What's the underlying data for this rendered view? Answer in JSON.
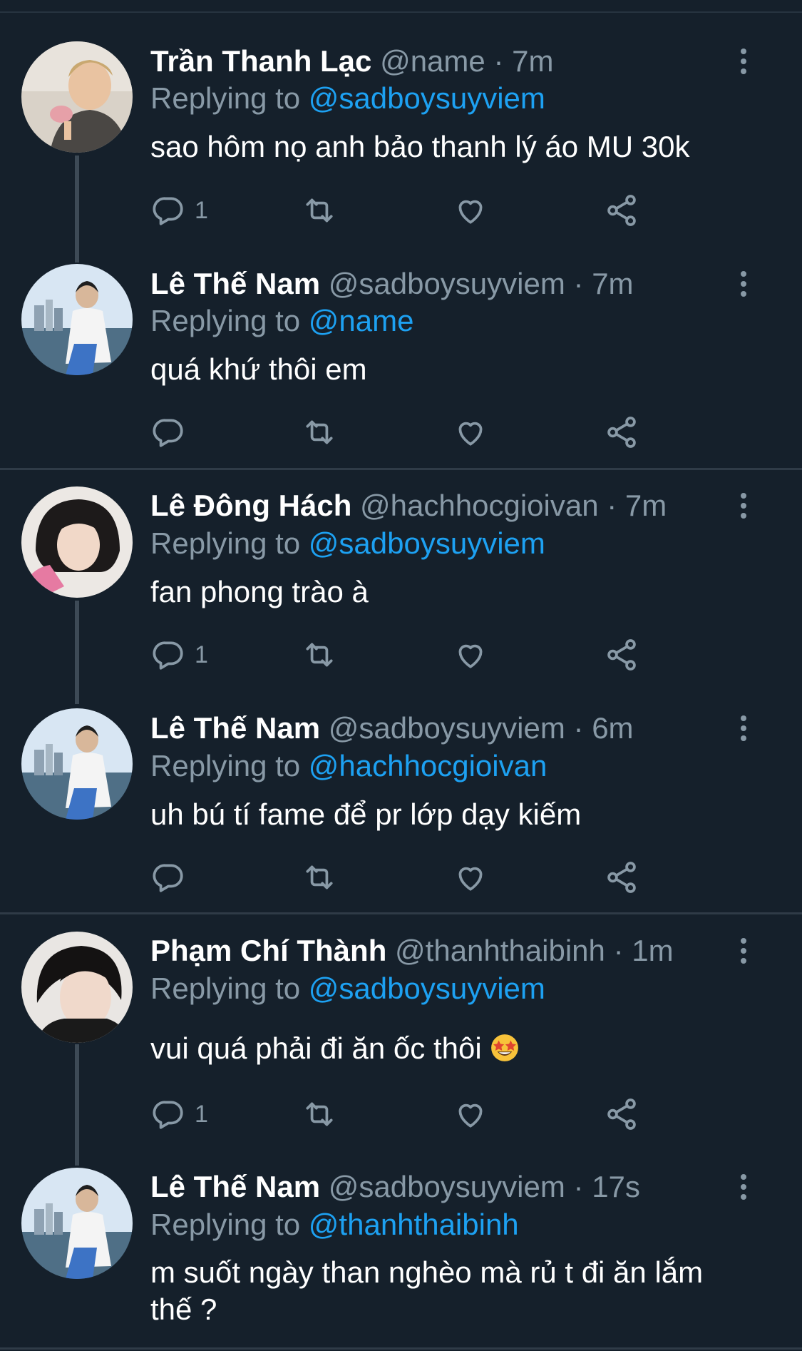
{
  "colors": {
    "background": "#15202b",
    "secondary_text": "#8899a6",
    "link": "#1da1f2",
    "divider": "#2f3b47"
  },
  "tweets": [
    {
      "name": "Trần Thanh Lạc",
      "handle": "@name",
      "sep": "·",
      "time": "7m",
      "replying_prefix": "Replying to",
      "replying_to": "@sadboysuyviem",
      "text": "sao hôm nọ anh bảo thanh lý áo MU 30k",
      "replies": "1"
    },
    {
      "name": "Lê Thế Nam",
      "handle": "@sadboysuyviem",
      "sep": "·",
      "time": "7m",
      "replying_prefix": "Replying to",
      "replying_to": "@name",
      "text": "quá khứ thôi em",
      "replies": ""
    },
    {
      "name": "Lê Đông Hách",
      "handle": "@hachhocgioivan",
      "sep": "·",
      "time": "7m",
      "replying_prefix": "Replying to",
      "replying_to": "@sadboysuyviem",
      "text": "fan phong trào à",
      "replies": "1"
    },
    {
      "name": "Lê Thế Nam",
      "handle": "@sadboysuyviem",
      "sep": "·",
      "time": "6m",
      "replying_prefix": "Replying to",
      "replying_to": "@hachhocgioivan",
      "text": "uh bú tí fame để pr lớp dạy kiếm",
      "replies": ""
    },
    {
      "name": "Phạm Chí Thành",
      "handle": "@thanhthaibinh",
      "sep": "·",
      "time": "1m",
      "replying_prefix": "Replying to",
      "replying_to": "@sadboysuyviem",
      "text": "vui quá phải đi ăn ốc thôi",
      "replies": "1"
    },
    {
      "name": "Lê Thế Nam",
      "handle": "@sadboysuyviem",
      "sep": "·",
      "time": "17s",
      "replying_prefix": "Replying to",
      "replying_to": "@thanhthaibinh",
      "text": "m suốt ngày than nghèo mà rủ t đi ăn lắm thế ?",
      "replies": ""
    }
  ],
  "icons": {
    "reply": "reply-icon",
    "retweet": "retweet-icon",
    "like": "heart-icon",
    "share": "share-icon",
    "more": "more-vertical-icon",
    "emoji": "star-struck-emoji"
  }
}
